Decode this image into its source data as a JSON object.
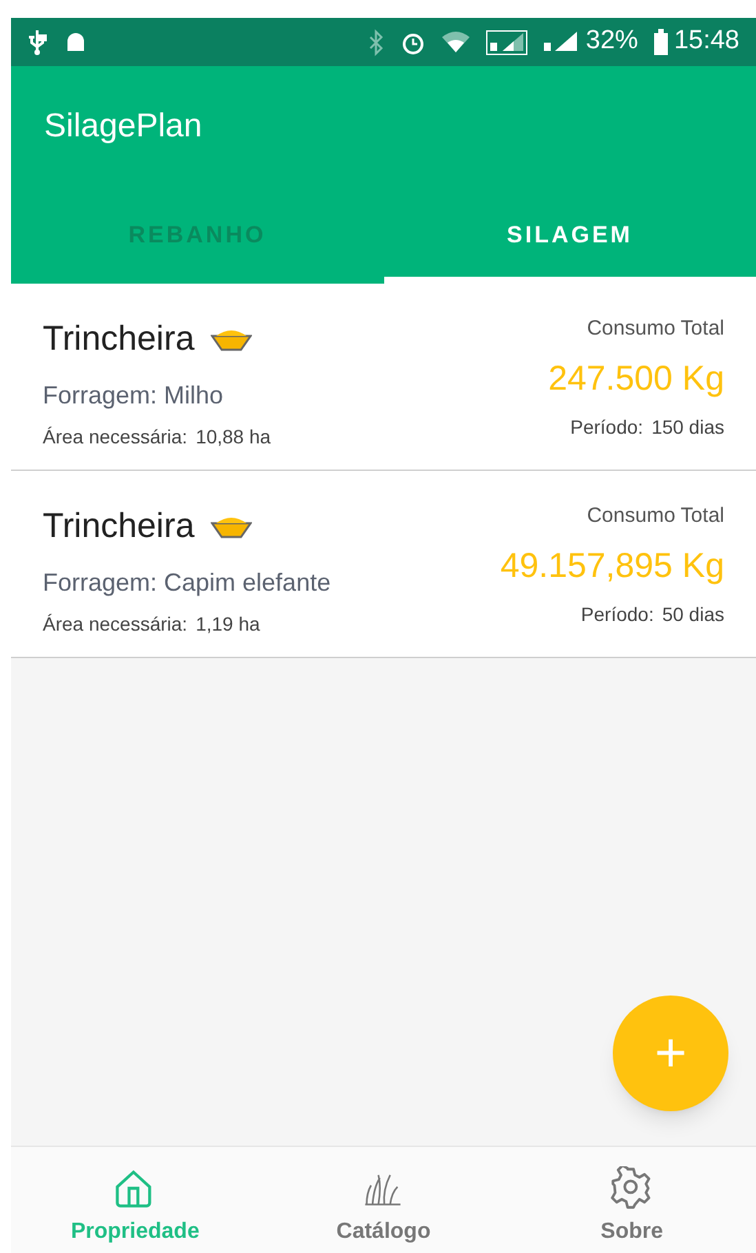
{
  "status_bar": {
    "battery": "32%",
    "time": "15:48"
  },
  "app_bar": {
    "title": "SilagePlan"
  },
  "tabs": [
    {
      "label": "REBANHO",
      "selected": false
    },
    {
      "label": "SILAGEM",
      "selected": true
    }
  ],
  "silos": [
    {
      "type": "Trincheira",
      "forage": "Forragem: Milho",
      "area_label": "Área necessária:",
      "area": "10,88 ha",
      "total_label": "Consumo Total",
      "total": "247.500 Kg",
      "period_label": "Período:",
      "period": "150 dias"
    },
    {
      "type": "Trincheira",
      "forage": "Forragem: Capim elefante",
      "area_label": "Área necessária:",
      "area": "1,19 ha",
      "total_label": "Consumo Total",
      "total": "49.157,895 Kg",
      "period_label": "Período:",
      "period": "50 dias"
    }
  ],
  "fab": {
    "label": "+"
  },
  "bottom_nav": [
    {
      "label": "Propriedade",
      "kind": "home",
      "selected": true
    },
    {
      "label": "Catálogo",
      "kind": "grass",
      "selected": false
    },
    {
      "label": "Sobre",
      "kind": "gear",
      "selected": false
    }
  ]
}
